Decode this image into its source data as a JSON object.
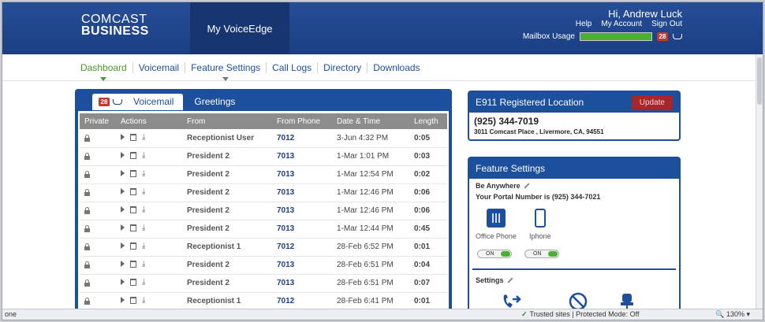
{
  "brand": {
    "line1": "COMCAST",
    "line2": "BUSINESS"
  },
  "app_tab": "My VoiceEdge",
  "user": {
    "greeting": "Hi, Andrew Luck",
    "links": [
      "Help",
      "My Account",
      "Sign Out"
    ],
    "mailbox_label": "Mailbox Usage",
    "mailbox_usage_fraction": 1.0,
    "badge_count": "28"
  },
  "nav": {
    "items": [
      "Dashboard",
      "Voicemail",
      "Feature Settings",
      "Call Logs",
      "Directory",
      "Downloads"
    ],
    "active": "Dashboard"
  },
  "voicemail": {
    "badge_count": "28",
    "tabs": [
      "Voicemail",
      "Greetings"
    ],
    "columns": [
      "Private",
      "Actions",
      "From",
      "From Phone",
      "Date & Time",
      "Length"
    ],
    "rows": [
      {
        "from": "Receptionist User",
        "phone": "7012",
        "datetime": "3-Jun 4:32 PM",
        "length": "0:05"
      },
      {
        "from": "President 2",
        "phone": "7013",
        "datetime": "1-Mar 1:01 PM",
        "length": "0:03"
      },
      {
        "from": "President 2",
        "phone": "7013",
        "datetime": "1-Mar 12:54 PM",
        "length": "0:02"
      },
      {
        "from": "President 2",
        "phone": "7013",
        "datetime": "1-Mar 12:46 PM",
        "length": "0:06"
      },
      {
        "from": "President 2",
        "phone": "7013",
        "datetime": "1-Mar 12:46 PM",
        "length": "0:06"
      },
      {
        "from": "President 2",
        "phone": "7013",
        "datetime": "1-Mar 12:44 PM",
        "length": "0:45"
      },
      {
        "from": "Receptionist 1",
        "phone": "7012",
        "datetime": "28-Feb 6:52 PM",
        "length": "0:01"
      },
      {
        "from": "President 2",
        "phone": "7013",
        "datetime": "28-Feb 6:51 PM",
        "length": "0:04"
      },
      {
        "from": "President 2",
        "phone": "7013",
        "datetime": "28-Feb 6:51 PM",
        "length": "0:07"
      },
      {
        "from": "Receptionist 1",
        "phone": "7012",
        "datetime": "28-Feb 6:41 PM",
        "length": "0:01"
      }
    ]
  },
  "e911": {
    "title": "E911 Registered Location",
    "update_label": "Update",
    "phone": "(925) 344-7019",
    "address": "3011 Comcast Place , Livermore, CA, 94551"
  },
  "feature_settings": {
    "title": "Feature Settings",
    "be_anywhere": "Be Anywhere",
    "portal_number": "Your Portal Number is (925) 344-7021",
    "devices": [
      {
        "label": "Office Phone",
        "icon": "desk-phone-icon",
        "toggle": "ON"
      },
      {
        "label": "Iphone",
        "icon": "mobile-phone-icon",
        "toggle": "ON"
      }
    ],
    "settings_label": "Settings"
  },
  "statusbar": {
    "left": "one",
    "trusted": "Trusted sites | Protected Mode: Off",
    "zoom": "130%"
  },
  "colors": {
    "brand_blue": "#1c4f9c",
    "header_blue": "#254d96",
    "active_green": "#4a9a26",
    "update_red": "#a8252b"
  }
}
